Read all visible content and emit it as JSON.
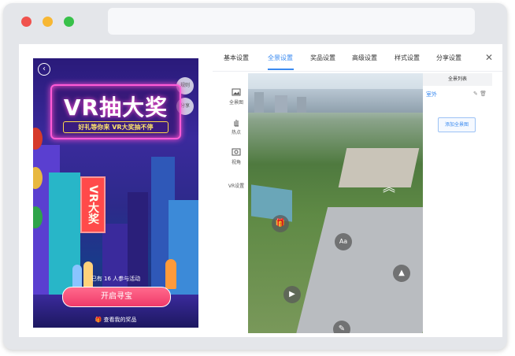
{
  "phone": {
    "banner_title": "VR抽大奖",
    "banner_subtitle": "好礼等你来 VR大奖抽不停",
    "side_buttons": [
      "规则",
      "分享"
    ],
    "sign_text": "VR大奖",
    "participants": "已有 16 人参与活动",
    "start_button": "开启寻宝",
    "view_prizes": "查看我的奖品"
  },
  "editor": {
    "tabs": [
      "基本设置",
      "全景设置",
      "奖品设置",
      "高级设置",
      "样式设置",
      "分享设置"
    ],
    "active_tab": "全景设置",
    "tools": [
      "全景图",
      "热点",
      "视角",
      "VR设置"
    ],
    "right_panel": {
      "header": "全景列表",
      "item": "室外",
      "add_button": "添加全景图"
    },
    "pano_controls": {
      "text_label": "Aa"
    }
  },
  "colors": {
    "accent": "#3a8af0",
    "start_button": "#f03a6a",
    "neon": "#ff4fd0"
  },
  "icons": [
    "gift-icon",
    "text-icon",
    "image-icon",
    "play-icon",
    "up-arrow-icon",
    "close-icon",
    "back-icon"
  ]
}
